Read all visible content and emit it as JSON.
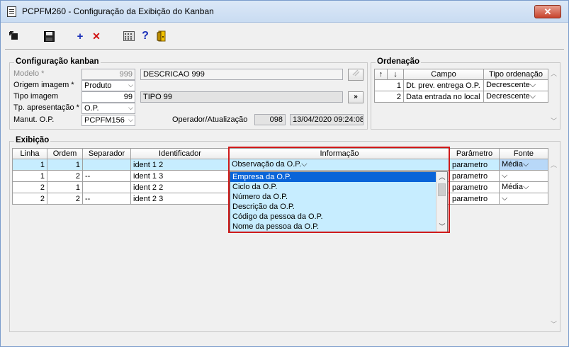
{
  "window": {
    "title": "PCPFM260 - Configuração da Exibição do Kanban",
    "close_symbol": "✕"
  },
  "toolbar": {
    "icons": [
      "nav-arrow-icon",
      "save-icon",
      "add-icon",
      "delete-icon",
      "calculator-icon",
      "help-icon",
      "exit-door-icon"
    ],
    "add_symbol": "+",
    "delete_symbol": "✕",
    "help_symbol": "?",
    "colors": {
      "add": "#1a2fb8",
      "delete": "#d01010",
      "help": "#1a2fb8"
    }
  },
  "config": {
    "legend": "Configuração kanban",
    "modelo": {
      "label": "Modelo *",
      "code": "999",
      "description": "DESCRICAO 999"
    },
    "origem_imagem": {
      "label": "Origem imagem *",
      "value": "Produto"
    },
    "tipo_imagem": {
      "label": "Tipo imagem",
      "code": "99",
      "description": "TIPO 99",
      "button": "»"
    },
    "tp_apresentacao": {
      "label": "Tp. apresentação *",
      "value": "O.P."
    },
    "manut_op": {
      "label": "Manut. O.P.",
      "value": "PCPFM156"
    },
    "operador": {
      "label": "Operador/Atualização",
      "code": "098",
      "datetime": "13/04/2020 09:24:08"
    }
  },
  "ordenacao": {
    "legend": "Ordenação",
    "headers": {
      "up": "↑",
      "down": "↓",
      "campo": "Campo",
      "tipo": "Tipo ordenação"
    },
    "rows": [
      {
        "num": "1",
        "campo": "Dt. prev. entrega O.P.",
        "tipo": "Decrescente"
      },
      {
        "num": "2",
        "campo": "Data entrada no local",
        "tipo": "Decrescente"
      }
    ]
  },
  "exibicao": {
    "legend": "Exibição",
    "headers": {
      "linha": "Linha",
      "ordem": "Ordem",
      "separador": "Separador",
      "identificador": "Identificador",
      "informacao": "Informação",
      "parametro": "Parâmetro",
      "fonte": "Fonte"
    },
    "rows": [
      {
        "linha": "1",
        "ordem": "1",
        "separador": "",
        "identificador": "ident 1 2",
        "informacao": "Observação da O.P.",
        "parametro": "parametro",
        "fonte": "Média"
      },
      {
        "linha": "1",
        "ordem": "2",
        "separador": "--",
        "identificador": "ident 1 3",
        "informacao": "",
        "parametro": "parametro",
        "fonte": ""
      },
      {
        "linha": "2",
        "ordem": "1",
        "separador": "",
        "identificador": "ident 2 2",
        "informacao": "",
        "parametro": "parametro",
        "fonte": "Média"
      },
      {
        "linha": "2",
        "ordem": "2",
        "separador": "--",
        "identificador": "ident 2 3",
        "informacao": "",
        "parametro": "parametro",
        "fonte": ""
      }
    ]
  },
  "dropdown": {
    "options": [
      "Empresa da O.P.",
      "Ciclo da O.P.",
      "Número da O.P.",
      "Descrição da O.P.",
      "Código da pessoa da O.P.",
      "Nome da pessoa da O.P."
    ],
    "highlighted": "Empresa da O.P."
  },
  "highlight_color": "#d01a1a"
}
